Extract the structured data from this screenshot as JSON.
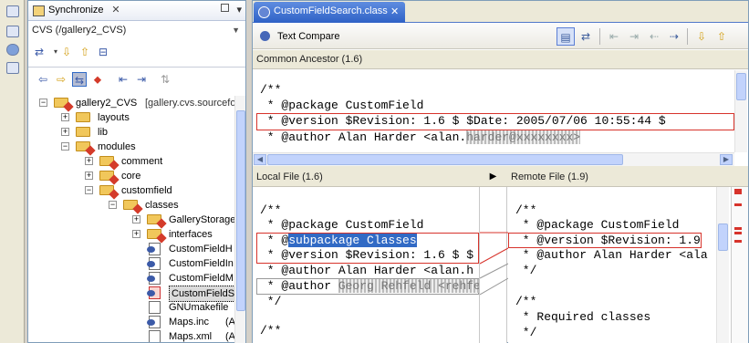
{
  "sync": {
    "tab_title": "Synchronize",
    "repository": "CVS (/gallery2_CVS)",
    "tree": [
      {
        "label": "gallery2_CVS",
        "extra": "[gallery.cvs.sourceforge",
        "depth": 0,
        "kind": "project"
      },
      {
        "label": "layouts",
        "depth": 1,
        "kind": "folder"
      },
      {
        "label": "lib",
        "depth": 1,
        "kind": "folder"
      },
      {
        "label": "modules",
        "depth": 1,
        "kind": "folder"
      },
      {
        "label": "comment",
        "depth": 2,
        "kind": "folder"
      },
      {
        "label": "core",
        "depth": 2,
        "kind": "folder"
      },
      {
        "label": "customfield",
        "depth": 2,
        "kind": "folder"
      },
      {
        "label": "classes",
        "depth": 3,
        "kind": "folder"
      },
      {
        "label": "GalleryStorage",
        "depth": 4,
        "kind": "folder"
      },
      {
        "label": "interfaces",
        "depth": 4,
        "kind": "folder"
      },
      {
        "label": "CustomFieldH",
        "depth": 4,
        "kind": "file"
      },
      {
        "label": "CustomFieldIn",
        "depth": 4,
        "kind": "file"
      },
      {
        "label": "CustomFieldM",
        "depth": 4,
        "kind": "file"
      },
      {
        "label": "CustomFieldS",
        "depth": 4,
        "kind": "file",
        "selected": true
      },
      {
        "label": "GNUmakefile",
        "depth": 4,
        "kind": "file"
      },
      {
        "label": "Maps.inc",
        "extra": "(A",
        "depth": 4,
        "kind": "file"
      },
      {
        "label": "Maps.xml",
        "extra": "(A",
        "depth": 4,
        "kind": "file"
      }
    ]
  },
  "editor": {
    "tab_title": "CustomFieldSearch.class",
    "compare_label": "Text Compare",
    "ancestor_header": "Common Ancestor (1.6)",
    "local_header": "Local File (1.6)",
    "remote_header": "Remote File (1.9)",
    "ancestor_lines": [
      "/**",
      " * @package CustomField",
      " * @version $Revision: 1.6 $ $Date: 2005/07/06 10:55:44 $",
      " * @author Alan Harder <alan."
    ],
    "ancestor_blur": "harder@xxxxxxxx>",
    "local_lines": [
      "/**",
      " * @package CustomField",
      " * @",
      " * @version $Revision: 1.6 $ $",
      " * @author Alan Harder <alan.h",
      " * @author ",
      " */",
      "",
      "/**"
    ],
    "local_subpackage": "subpackage Classes",
    "local_blur": "Georg Rehfeld <rehfe",
    "remote_lines": [
      "/**",
      " * @package CustomField",
      " * @version $Revision: 1.9",
      " * @author Alan Harder <ala",
      " */",
      "",
      "/**",
      " * Required classes",
      " */"
    ]
  }
}
